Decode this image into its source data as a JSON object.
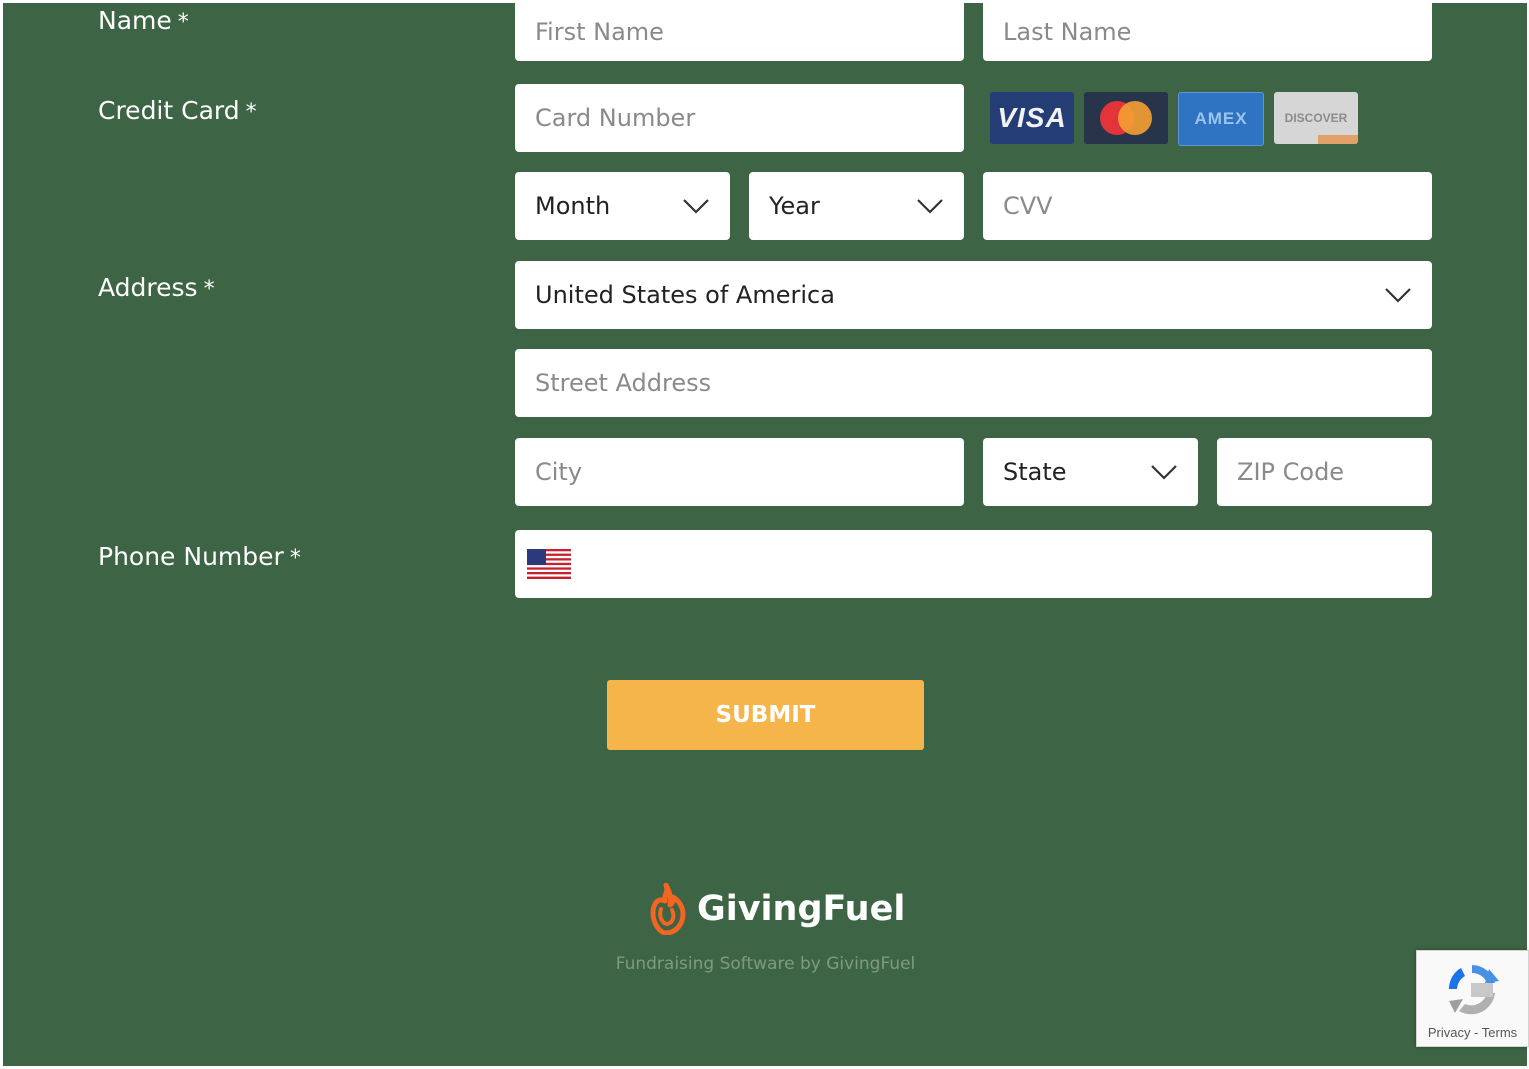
{
  "form": {
    "name_label": "Name",
    "credit_card_label": "Credit Card",
    "address_label": "Address",
    "phone_label": "Phone Number",
    "required_marker": "*",
    "first_name_placeholder": "First Name",
    "last_name_placeholder": "Last Name",
    "card_number_placeholder": "Card Number",
    "month_select": "Month",
    "year_select": "Year",
    "cvv_placeholder": "CVV",
    "country_select": "United States of America",
    "street_placeholder": "Street Address",
    "city_placeholder": "City",
    "state_select": "State",
    "zip_placeholder": "ZIP Code",
    "phone_value": "",
    "phone_flag": "us-flag-icon"
  },
  "card_logos": {
    "visa": "VISA",
    "mastercard": "",
    "amex": "AMEX",
    "discover": "DISCOVER"
  },
  "submit_label": "SUBMIT",
  "footer": {
    "brand": "GivingFuel",
    "tagline": "Fundraising Software by GivingFuel",
    "logo_icon": "flame-icon"
  },
  "recaptcha": {
    "links": "Privacy - Terms"
  },
  "colors": {
    "background": "#3d6444",
    "submit": "#f5b54a",
    "brand_flame": "#f26522"
  }
}
